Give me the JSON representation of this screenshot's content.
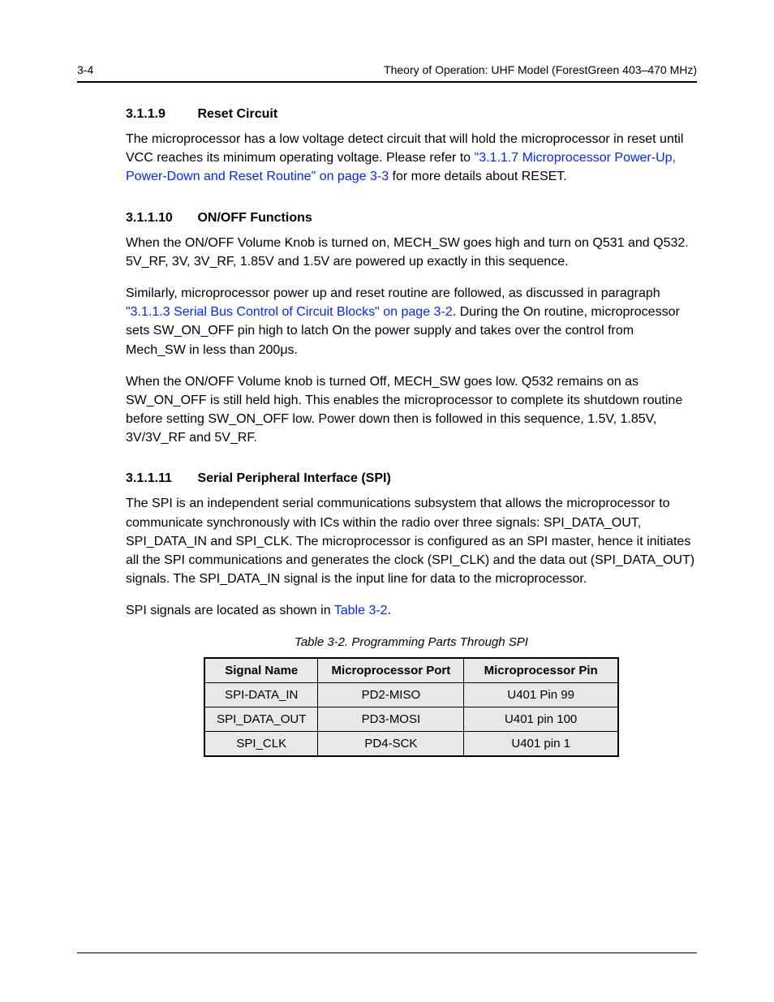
{
  "header": {
    "left": "3-4",
    "right": "Theory of Operation: UHF Model (ForestGreen 403–470 MHz)"
  },
  "sections": [
    {
      "num": "3.1.1.9",
      "title": "Reset Circuit"
    },
    {
      "num": "3.1.1.10",
      "title": "ON/OFF Functions"
    },
    {
      "num": "3.1.1.11",
      "title": "Serial Peripheral Interface (SPI)"
    }
  ],
  "paragraphs": {
    "reset_p1_a": "The microprocessor has a low voltage detect circuit that will hold the microprocessor in reset until VCC reaches its minimum operating voltage. Please refer to ",
    "reset_link": "\"3.1.1.7 Microprocessor Power-Up, Power-Down and Reset Routine\" on page 3-3",
    "reset_p1_b": " for more details about RESET."
  },
  "onoff": {
    "p1": "When the ON/OFF Volume Knob is turned on, MECH_SW goes high and turn on Q531 and Q532. 5V_RF, 3V, 3V_RF, 1.85V and 1.5V are powered up exactly in this sequence.",
    "p2_a": "Similarly, microprocessor power up and reset routine are followed, as discussed in paragraph ",
    "p2_link": "\"3.1.1.3 Serial Bus Control of Circuit Blocks\" on page 3-2",
    "p2_b": ". During the On routine, microprocessor sets SW_ON_OFF pin high to latch On the power supply and takes over the control from Mech_SW in less than 200μs.",
    "p3": "When the ON/OFF Volume knob is turned Off, MECH_SW goes low. Q532 remains on as SW_ON_OFF is still held high. This enables the microprocessor to complete its shutdown routine before setting SW_ON_OFF low. Power down then is followed in this sequence, 1.5V, 1.85V, 3V/3V_RF and 5V_RF."
  },
  "spi": {
    "p1": "The SPI is an independent serial communications subsystem that allows the microprocessor to communicate synchronously with ICs within the radio over three signals: SPI_DATA_OUT, SPI_DATA_IN and SPI_CLK. The microprocessor is configured as an SPI master, hence it initiates all the SPI communications and generates the clock (SPI_CLK) and the data out (SPI_DATA_OUT) signals. The SPI_DATA_IN signal is the input line for data to the microprocessor.",
    "p2_a": "SPI signals are located as shown in ",
    "p2_link": "Table 3-2",
    "p2_b": "."
  },
  "table": {
    "caption": "Table 3-2. Programming Parts Through SPI",
    "headers": [
      "Signal Name",
      "Microprocessor Port",
      "Microprocessor Pin"
    ],
    "rows": [
      [
        "SPI-DATA_IN",
        "PD2-MISO",
        "U401 Pin 99"
      ],
      [
        "SPI_DATA_OUT",
        "PD3-MOSI",
        "U401 pin 100"
      ],
      [
        "SPI_CLK",
        "PD4-SCK",
        "U401 pin 1"
      ]
    ]
  },
  "chart_data": {
    "type": "table",
    "title": "Table 3-2. Programming Parts Through SPI",
    "columns": [
      "Signal Name",
      "Microprocessor Port",
      "Microprocessor Pin"
    ],
    "rows": [
      {
        "Signal Name": "SPI-DATA_IN",
        "Microprocessor Port": "PD2-MISO",
        "Microprocessor Pin": "U401 Pin 99"
      },
      {
        "Signal Name": "SPI_DATA_OUT",
        "Microprocessor Port": "PD3-MOSI",
        "Microprocessor Pin": "U401 pin 100"
      },
      {
        "Signal Name": "SPI_CLK",
        "Microprocessor Port": "PD4-SCK",
        "Microprocessor Pin": "U401 pin 1"
      }
    ]
  }
}
